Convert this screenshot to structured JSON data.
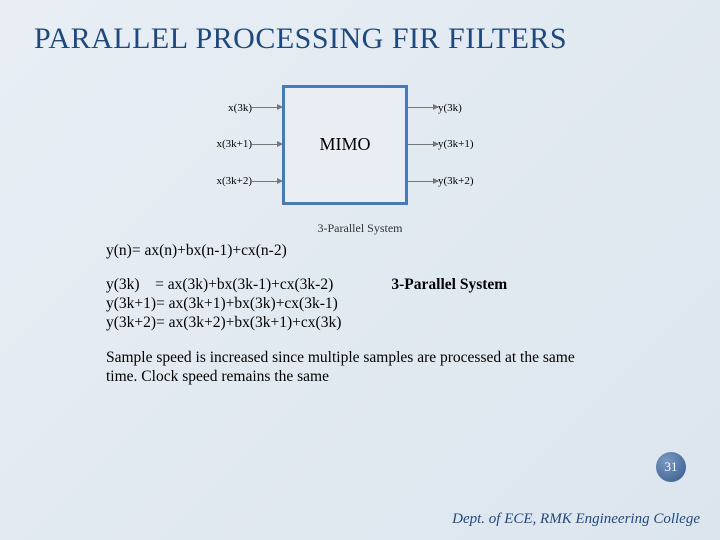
{
  "title": "PARALLEL PROCESSING FIR FILTERS",
  "figure": {
    "inputs": [
      "x(3k)",
      "x(3k+1)",
      "x(3k+2)"
    ],
    "box_label": "MIMO",
    "outputs": [
      "y(3k)",
      "y(3k+1)",
      "y(3k+2)"
    ],
    "caption": "3-Parallel System"
  },
  "equations": {
    "base": "y(n)= ax(n)+bx(n-1)+cx(n-2)",
    "parallel": [
      "y(3k)    = ax(3k)+bx(3k-1)+cx(3k-2)",
      "y(3k+1)= ax(3k+1)+bx(3k)+cx(3k-1)",
      "y(3k+2)= ax(3k+2)+bx(3k+1)+cx(3k)"
    ],
    "system_label": "3-Parallel System"
  },
  "summary": "Sample speed is increased since multiple samples are processed at the same time. Clock speed remains the same",
  "page_number": "31",
  "footer": "Dept. of ECE, RMK Engineering College"
}
